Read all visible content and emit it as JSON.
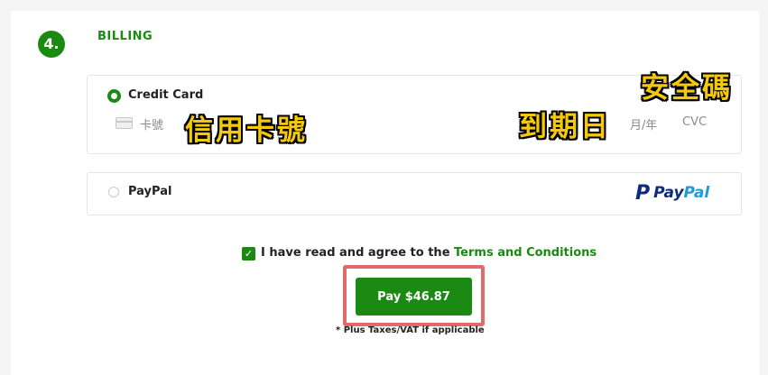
{
  "section": {
    "step": "4.",
    "title": "BILLING"
  },
  "credit_card": {
    "label": "Credit Card",
    "card_number_placeholder": "卡號",
    "expiry_placeholder": "月/年",
    "cvc_placeholder": "CVC"
  },
  "paypal": {
    "label": "PayPal",
    "logo_pay": "Pay",
    "logo_pal": "Pal",
    "logo_mark": "P"
  },
  "annotations": {
    "card_number": "信用卡號",
    "expiry": "到期日",
    "security_code": "安全碼"
  },
  "agreement": {
    "text": "I have read and agree to the ",
    "link": "Terms and Conditions",
    "check": "✓"
  },
  "pay_button": {
    "label": "Pay $46.87"
  },
  "tax_note": "* Plus Taxes/VAT if applicable",
  "colors": {
    "accent": "#1a8a12",
    "annotation": "#f4c90d",
    "highlight": "#e26a6a",
    "paypal_dark": "#0d2d7a",
    "paypal_light": "#1c9ddb"
  }
}
